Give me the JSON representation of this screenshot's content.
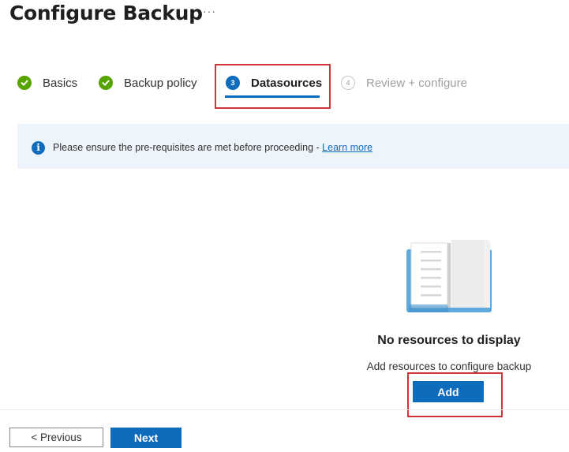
{
  "header": {
    "title": "Configure Backup",
    "more_label": "···"
  },
  "steps": [
    {
      "label": "Basics",
      "status": "complete",
      "icon": "check-circle-icon"
    },
    {
      "label": "Backup policy",
      "status": "complete",
      "icon": "check-circle-icon"
    },
    {
      "label": "Datasources",
      "status": "active",
      "number": "3"
    },
    {
      "label": "Review + configure",
      "status": "pending",
      "number": "4"
    }
  ],
  "info_bar": {
    "icon": "info-icon",
    "icon_glyph": "i",
    "message": "Please ensure the pre-requisites are met before proceeding - ",
    "link_text": "Learn more"
  },
  "empty_state": {
    "icon": "open-book-icon",
    "title": "No resources to display",
    "subtitle": "Add resources to configure backup",
    "add_label": "Add"
  },
  "footer": {
    "previous_label": "< Previous",
    "next_label": "Next"
  },
  "colors": {
    "accent": "#0f6cbd",
    "success": "#57a300",
    "highlight_box": "#d13438",
    "info_background": "#eef4fb"
  }
}
